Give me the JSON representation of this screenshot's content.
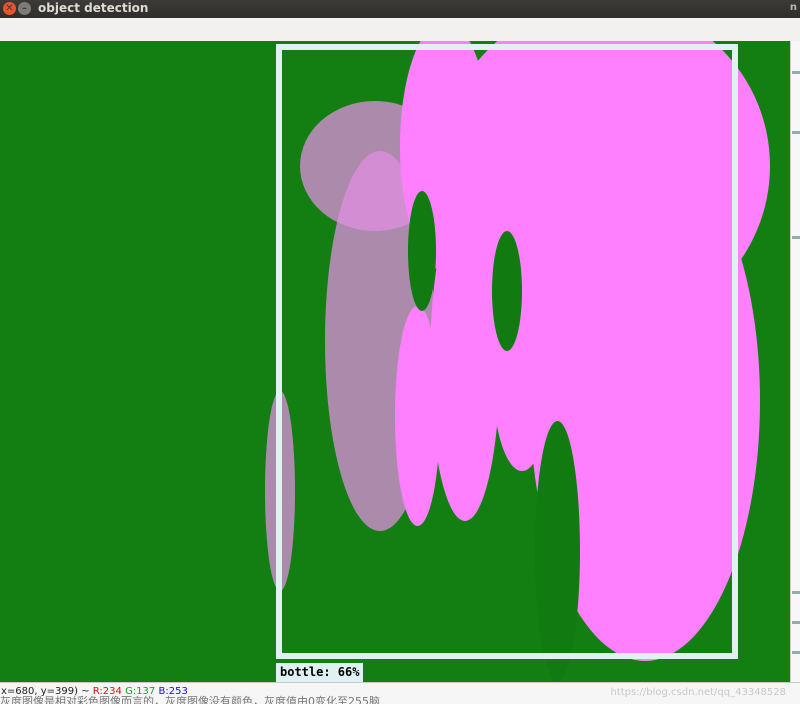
{
  "window": {
    "title": "object detection",
    "close_icon": "close-icon",
    "minimize_icon": "minimize-icon",
    "edge_char": "n"
  },
  "detection": {
    "label": "bottle: 66%",
    "class": "bottle",
    "confidence_percent": 66,
    "box_color": "#dff1f1"
  },
  "image": {
    "background_color": "#137f13",
    "foreground_color": "#ff80ff"
  },
  "status": {
    "coords": "x=680, y=399) ~",
    "r_label": "R:234",
    "g_label": "G:137",
    "b_label": "B:253"
  },
  "background_text": {
    "line": "灰度图像是相对彩色图像而言的，灰度图像没有颜色，灰度值由0变化至255脑",
    "watermark": "https://blog.csdn.net/qq_43348528"
  }
}
